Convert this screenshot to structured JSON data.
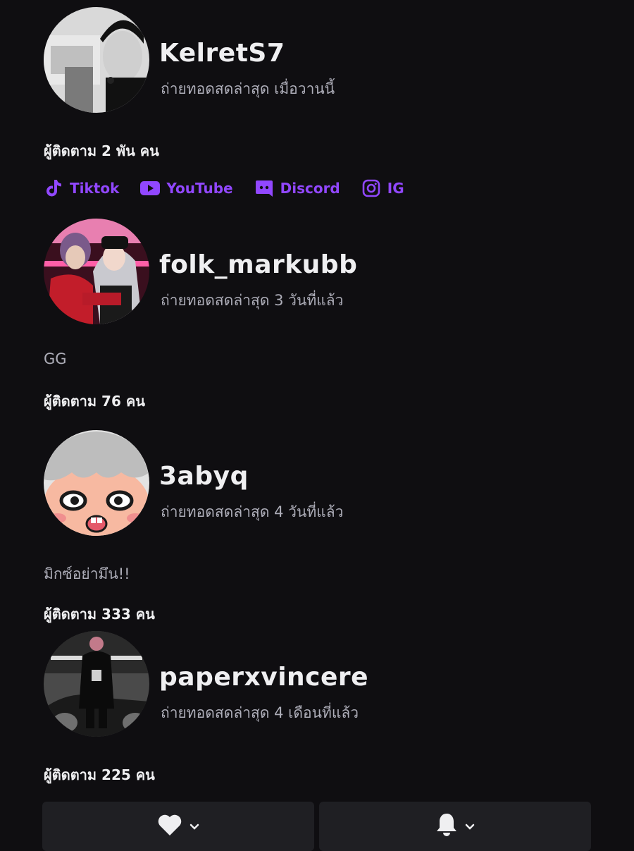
{
  "channels": [
    {
      "name": "KelretS7",
      "last_live": "ถ่ายทอดสดล่าสุด เมื่อวานนี้",
      "bio": "",
      "followers": "ผู้ติดตาม 2 พัน คน",
      "links": [
        {
          "label": "Tiktok",
          "icon": "tiktok-icon"
        },
        {
          "label": "YouTube",
          "icon": "youtube-icon"
        },
        {
          "label": "Discord",
          "icon": "discord-icon"
        },
        {
          "label": "IG",
          "icon": "instagram-icon"
        }
      ]
    },
    {
      "name": "folk_markubb",
      "last_live": "ถ่ายทอดสดล่าสุด 3 วันที่แล้ว",
      "bio": "GG",
      "followers": "ผู้ติดตาม 76 คน"
    },
    {
      "name": "3abyq",
      "last_live": "ถ่ายทอดสดล่าสุด 4 วันที่แล้ว",
      "bio": "มิกซ์อย่ามึน!!",
      "followers": "ผู้ติดตาม 333 คน"
    },
    {
      "name": "paperxvincere",
      "last_live": "ถ่ายทอดสดล่าสุด 4 เดือนที่แล้ว",
      "bio": "",
      "followers": "ผู้ติดตาม 225 คน"
    }
  ],
  "actions": {
    "follow_icon": "heart-icon",
    "notify_icon": "bell-icon",
    "dropdown_icon": "chevron-down-icon"
  },
  "colors": {
    "background": "#0f0e11",
    "accent": "#9147ff",
    "text_primary": "#efeff1",
    "text_secondary": "#adadb8",
    "button_bg": "#1f1f23"
  }
}
